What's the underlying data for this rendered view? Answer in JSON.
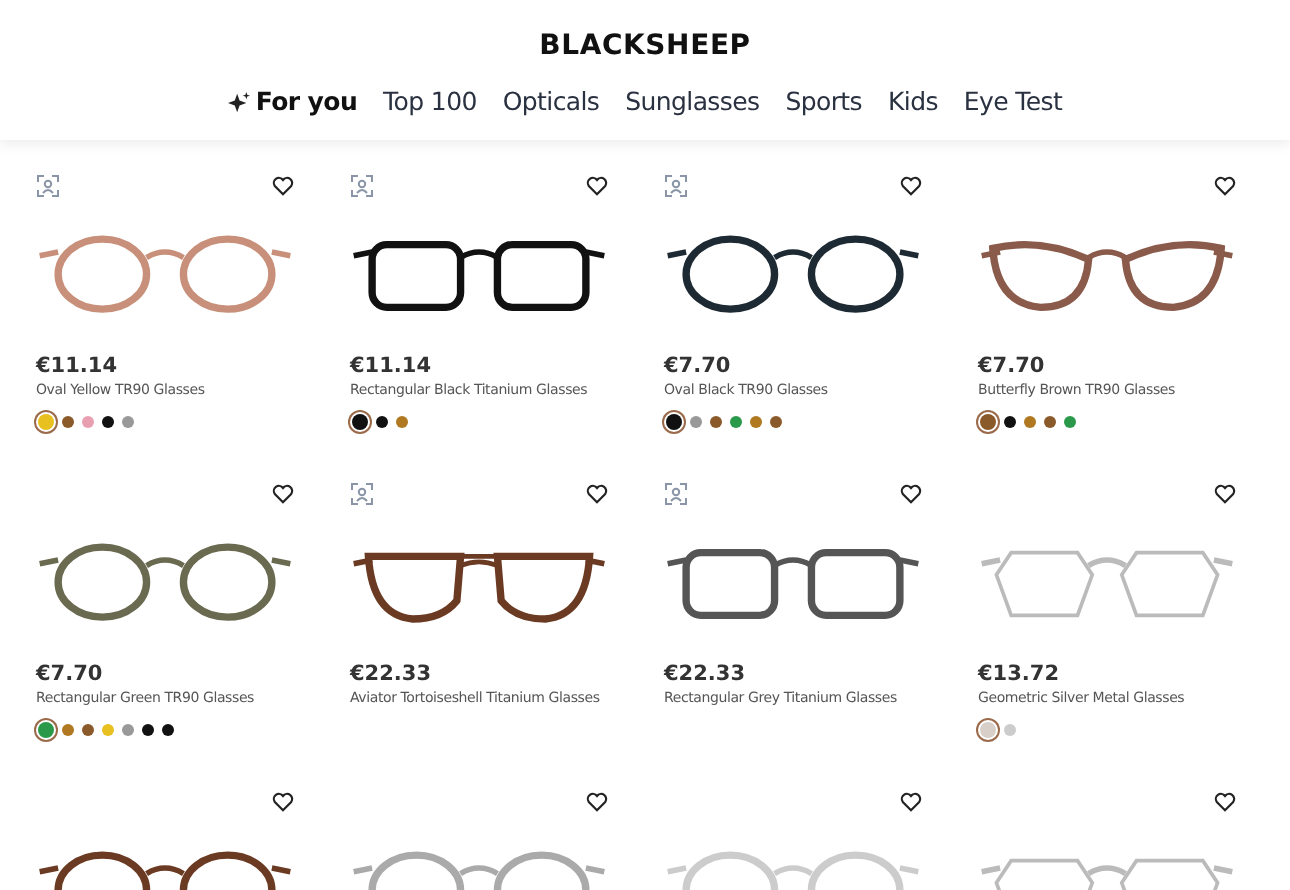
{
  "brand": "BLACKSHEEP",
  "nav": [
    {
      "label": "For you",
      "selected": true,
      "kind": "featured"
    },
    {
      "label": "Top 100",
      "selected": false
    },
    {
      "label": "Opticals",
      "selected": false
    },
    {
      "label": "Sunglasses",
      "selected": false
    },
    {
      "label": "Sports",
      "selected": false
    },
    {
      "label": "Kids",
      "selected": false
    },
    {
      "label": "Eye Test",
      "selected": false
    }
  ],
  "products": [
    {
      "try_on": true,
      "kind": "round",
      "color": "#c8907a",
      "price": "€11.14",
      "name": "Oval Yellow TR90 Glasses",
      "swatches": [
        {
          "color": "#e8c020",
          "selected": true
        },
        {
          "color": "#8b5a2b",
          "selected": false
        },
        {
          "color": "#e8a0b0",
          "selected": false
        },
        {
          "color": "#111111",
          "selected": false
        },
        {
          "color": "#999999",
          "selected": false
        }
      ]
    },
    {
      "try_on": true,
      "kind": "rect",
      "color": "#111111",
      "price": "€11.14",
      "name": "Rectangular Black Titanium Glasses",
      "swatches": [
        {
          "color": "#111111",
          "selected": true
        },
        {
          "color": "#111111",
          "selected": false
        },
        {
          "color": "#b07820",
          "selected": false
        }
      ]
    },
    {
      "try_on": true,
      "kind": "round",
      "color": "#1d2a33",
      "price": "€7.70",
      "name": "Oval Black TR90 Glasses",
      "swatches": [
        {
          "color": "#111111",
          "selected": true
        },
        {
          "color": "#999999",
          "selected": false
        },
        {
          "color": "#8b5a2b",
          "selected": false
        },
        {
          "color": "#2a9a4a",
          "selected": false
        },
        {
          "color": "#b07820",
          "selected": false
        },
        {
          "color": "#8b5a2b",
          "selected": false
        }
      ]
    },
    {
      "try_on": false,
      "kind": "cateye",
      "color": "#8a5a4a",
      "price": "€7.70",
      "name": "Butterfly Brown TR90 Glasses",
      "swatches": [
        {
          "color": "#8b5a2b",
          "selected": true
        },
        {
          "color": "#111111",
          "selected": false
        },
        {
          "color": "#b07820",
          "selected": false
        },
        {
          "color": "#8b5a2b",
          "selected": false
        },
        {
          "color": "#2a9a4a",
          "selected": false
        }
      ]
    },
    {
      "try_on": false,
      "kind": "round",
      "color": "#6a6a50",
      "price": "€7.70",
      "name": "Rectangular Green TR90 Glasses",
      "swatches": [
        {
          "color": "#2a9a4a",
          "selected": true
        },
        {
          "color": "#b07820",
          "selected": false
        },
        {
          "color": "#8b5a2b",
          "selected": false
        },
        {
          "color": "#e8c020",
          "selected": false
        },
        {
          "color": "#999999",
          "selected": false
        },
        {
          "color": "#111111",
          "selected": false
        },
        {
          "color": "#111111",
          "selected": false
        }
      ]
    },
    {
      "try_on": true,
      "kind": "aviator",
      "color": "#6b3a22",
      "price": "€22.33",
      "name": "Aviator Tortoiseshell Titanium Glasses"
    },
    {
      "try_on": true,
      "kind": "rect",
      "color": "#555555",
      "price": "€22.33",
      "name": "Rectangular Grey Titanium Glasses"
    },
    {
      "try_on": false,
      "kind": "geometric",
      "color": "#bbbbbb",
      "price": "€13.72",
      "name": "Geometric Silver Metal Glasses",
      "swatches": [
        {
          "color": "#d8d0c8",
          "selected": true
        },
        {
          "color": "#cccccc",
          "selected": false
        }
      ]
    },
    {
      "try_on": false,
      "kind": "round",
      "color": "#6b3a22"
    },
    {
      "try_on": false,
      "kind": "round",
      "color": "#aaaaaa"
    },
    {
      "try_on": false,
      "kind": "round",
      "color": "#cccccc"
    },
    {
      "try_on": false,
      "kind": "geometric",
      "color": "#bbbbbb"
    }
  ]
}
